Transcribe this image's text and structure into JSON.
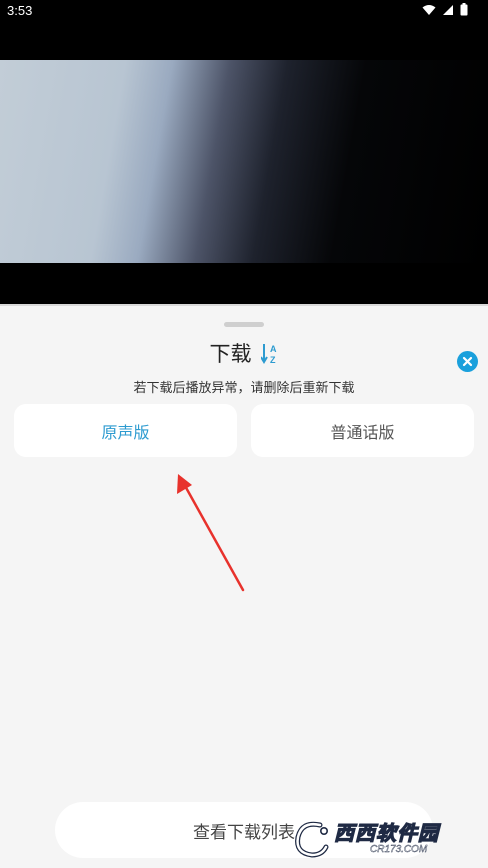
{
  "status_bar": {
    "time": "3:53",
    "icons": [
      "wifi-icon",
      "signal-icon",
      "battery-icon"
    ]
  },
  "sheet": {
    "title": "下载",
    "notice": "若下载后播放异常，请删除后重新下载",
    "sort_icon_letters": {
      "top": "A",
      "bottom": "Z"
    },
    "versions": [
      {
        "label": "原声版",
        "selected": true
      },
      {
        "label": "普通话版",
        "selected": false
      }
    ],
    "list_button_label": "查看下载列表"
  },
  "watermark": {
    "main": "西西软件园",
    "sub": "CR173.COM"
  },
  "colors": {
    "accent": "#2d9bd0",
    "close": "#1aa0dc",
    "arrow": "#e8322c",
    "sheet_bg": "#f5f5f5"
  }
}
